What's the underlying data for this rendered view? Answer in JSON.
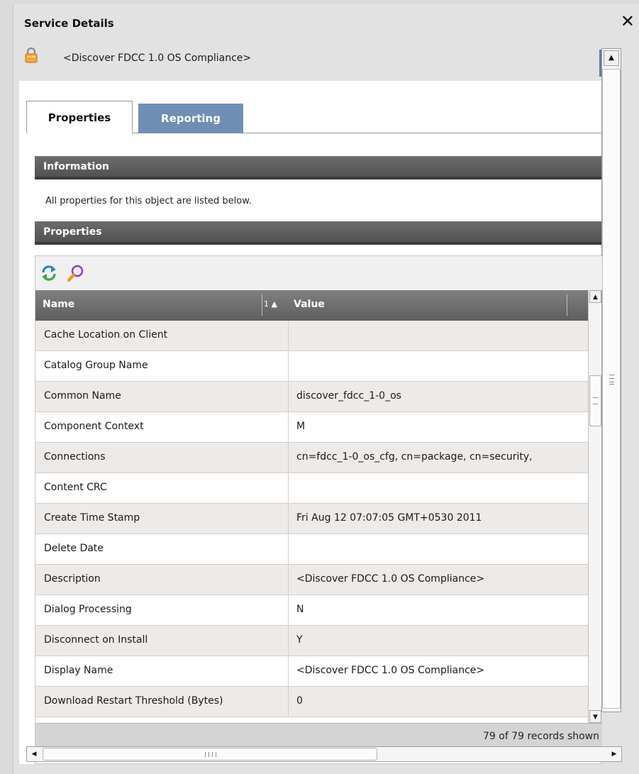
{
  "dialog": {
    "title": "Service Details",
    "close_icon": "close-icon",
    "object_icon": "lock-icon",
    "object_name": "<Discover FDCC 1.0 OS Compliance>"
  },
  "tabs": [
    {
      "label": "Properties",
      "active": true
    },
    {
      "label": "Reporting",
      "active": false
    }
  ],
  "information": {
    "header": "Information",
    "text": "All properties for this object are listed below."
  },
  "properties": {
    "header": "Properties",
    "toolbar": [
      "refresh-icon",
      "search-icon"
    ],
    "columns": {
      "name": "Name",
      "sort_indicator": "1 ▲",
      "value": "Value"
    },
    "rows": [
      {
        "name": "Cache Location on Client",
        "value": ""
      },
      {
        "name": "Catalog Group Name",
        "value": ""
      },
      {
        "name": "Common Name",
        "value": "discover_fdcc_1-0_os"
      },
      {
        "name": "Component Context",
        "value": "M"
      },
      {
        "name": "Connections",
        "value": "cn=fdcc_1-0_os_cfg, cn=package, cn=security,"
      },
      {
        "name": "Content CRC",
        "value": ""
      },
      {
        "name": "Create Time Stamp",
        "value": "Fri Aug 12 07:07:05 GMT+0530 2011"
      },
      {
        "name": "Delete Date",
        "value": ""
      },
      {
        "name": "Description",
        "value": "<Discover FDCC 1.0 OS Compliance>"
      },
      {
        "name": "Dialog Processing",
        "value": "N"
      },
      {
        "name": "Disconnect on Install",
        "value": "Y"
      },
      {
        "name": "Display Name",
        "value": "<Discover FDCC 1.0 OS Compliance>"
      },
      {
        "name": "Download Restart Threshold (Bytes)",
        "value": "0"
      }
    ],
    "status": "79 of 79 records shown"
  },
  "colors": {
    "header_bg": "#5e5e5e",
    "inactive_tab": "#6e8fb3",
    "row_alt": "#eeeae8"
  }
}
